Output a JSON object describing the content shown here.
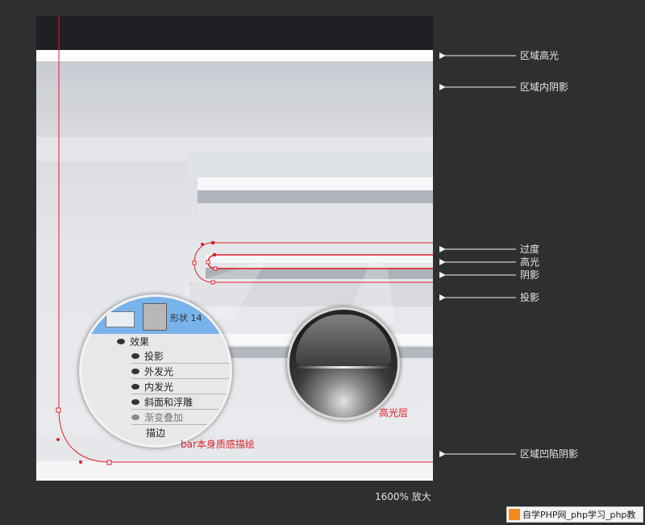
{
  "labels": {
    "region_highlight": "区域高光",
    "region_inner_shadow": "区域内阴影",
    "transition": "过度",
    "highlight": "高光",
    "shadow": "阴影",
    "drop_shadow": "投影",
    "region_recess_shadow": "区域凹陷阴影"
  },
  "annotations": {
    "highlight_layer": "高光层",
    "bar_texture": "bar本身质感描绘"
  },
  "zoom_label": "1600% 放大",
  "layer_panel": {
    "layer_name": "形状 14",
    "effects_title": "效果",
    "effects": [
      "投影",
      "外发光",
      "内发光",
      "斜面和浮雕",
      "渐变叠加",
      "描边"
    ]
  },
  "watermark": "自学PHP网_php学习_php教",
  "colors": {
    "accent_red": "#e0202a",
    "background": "#2e2f31",
    "panel_blue": "#79b3ec"
  }
}
